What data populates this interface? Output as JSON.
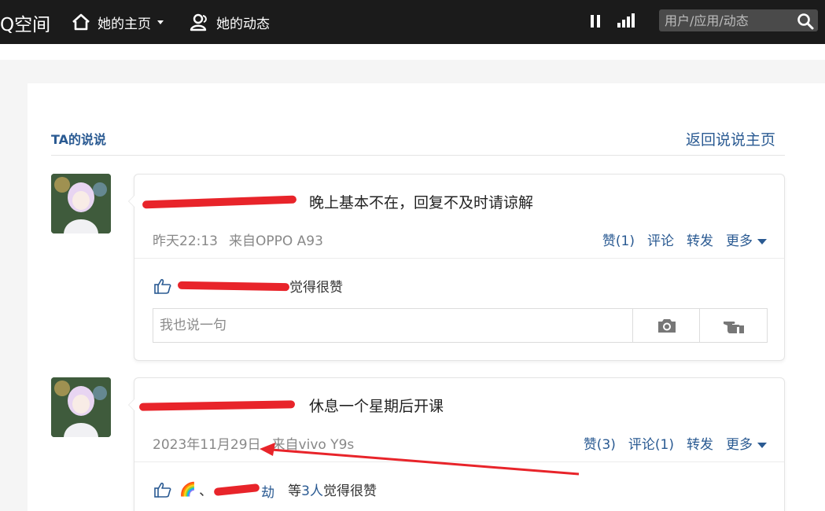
{
  "topbar": {
    "brand": "Q空间",
    "nav_home": "她的主页",
    "nav_feed": "她的动态",
    "search_placeholder": "用户/应用/动态"
  },
  "section": {
    "title": "TA的说说",
    "back_link": "返回说说主页"
  },
  "posts": [
    {
      "text": "晚上基本不在，回复不及时请谅解",
      "time": "昨天22:13",
      "source": "来自OPPO A93",
      "actions": {
        "like": "赞(1)",
        "comment": "评论",
        "share": "转发",
        "more": "更多"
      },
      "likes_suffix": "觉得很赞",
      "comment_placeholder": "我也说一句"
    },
    {
      "text": "休息一个星期后开课",
      "time": "2023年11月29日",
      "source": "来自vivo Y9s",
      "actions": {
        "like": "赞(3)",
        "comment": "评论(1)",
        "share": "转发",
        "more": "更多"
      },
      "likes_emoji": "🌈",
      "likes_sep": "、",
      "likes_count_prefix": "等",
      "likes_count": "3人",
      "likes_suffix": "觉得很赞"
    }
  ],
  "colors": {
    "topbar": "#1b1b1b",
    "link": "#2a5a92",
    "redaction": "#e8242a"
  }
}
